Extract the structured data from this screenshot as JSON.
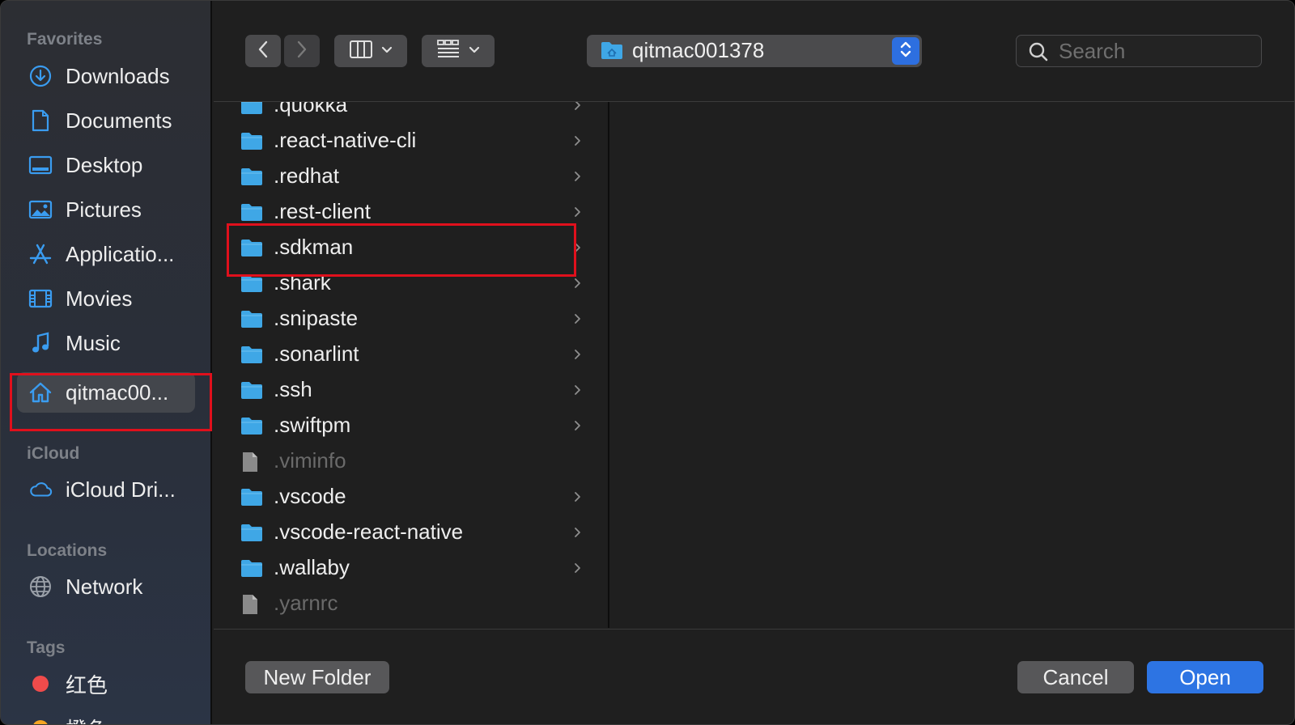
{
  "sidebar": {
    "sections": {
      "favorites": "Favorites",
      "icloud": "iCloud",
      "locations": "Locations",
      "tags": "Tags"
    },
    "favorites": [
      {
        "label": "Downloads",
        "icon": "downloads-icon"
      },
      {
        "label": "Documents",
        "icon": "documents-icon"
      },
      {
        "label": "Desktop",
        "icon": "desktop-icon"
      },
      {
        "label": "Pictures",
        "icon": "pictures-icon"
      },
      {
        "label": "Applicatio...",
        "icon": "applications-icon"
      },
      {
        "label": "Movies",
        "icon": "movies-icon"
      },
      {
        "label": "Music",
        "icon": "music-icon"
      },
      {
        "label": "qitmac00...",
        "icon": "home-icon",
        "selected": true
      }
    ],
    "icloud": [
      {
        "label": "iCloud Dri...",
        "icon": "icloud-icon"
      }
    ],
    "locations": [
      {
        "label": "Network",
        "icon": "network-icon"
      }
    ],
    "tags": [
      {
        "label": "红色",
        "color": "#f04b4b"
      },
      {
        "label": "橙色",
        "color": "#f5a623"
      }
    ]
  },
  "toolbar": {
    "path_label": "qitmac001378",
    "search_placeholder": "Search"
  },
  "files": [
    {
      "name": ".quokka",
      "type": "folder"
    },
    {
      "name": ".react-native-cli",
      "type": "folder"
    },
    {
      "name": ".redhat",
      "type": "folder"
    },
    {
      "name": ".rest-client",
      "type": "folder"
    },
    {
      "name": ".sdkman",
      "type": "folder"
    },
    {
      "name": ".shark",
      "type": "folder"
    },
    {
      "name": ".snipaste",
      "type": "folder"
    },
    {
      "name": ".sonarlint",
      "type": "folder"
    },
    {
      "name": ".ssh",
      "type": "folder"
    },
    {
      "name": ".swiftpm",
      "type": "folder"
    },
    {
      "name": ".viminfo",
      "type": "file"
    },
    {
      "name": ".vscode",
      "type": "folder"
    },
    {
      "name": ".vscode-react-native",
      "type": "folder"
    },
    {
      "name": ".wallaby",
      "type": "folder"
    },
    {
      "name": ".yarnrc",
      "type": "file"
    }
  ],
  "footer": {
    "new_folder": "New Folder",
    "cancel": "Cancel",
    "open": "Open"
  },
  "colors": {
    "accent": "#2d74e3",
    "folder": "#3fa7e6",
    "highlight": "#e0101c"
  }
}
